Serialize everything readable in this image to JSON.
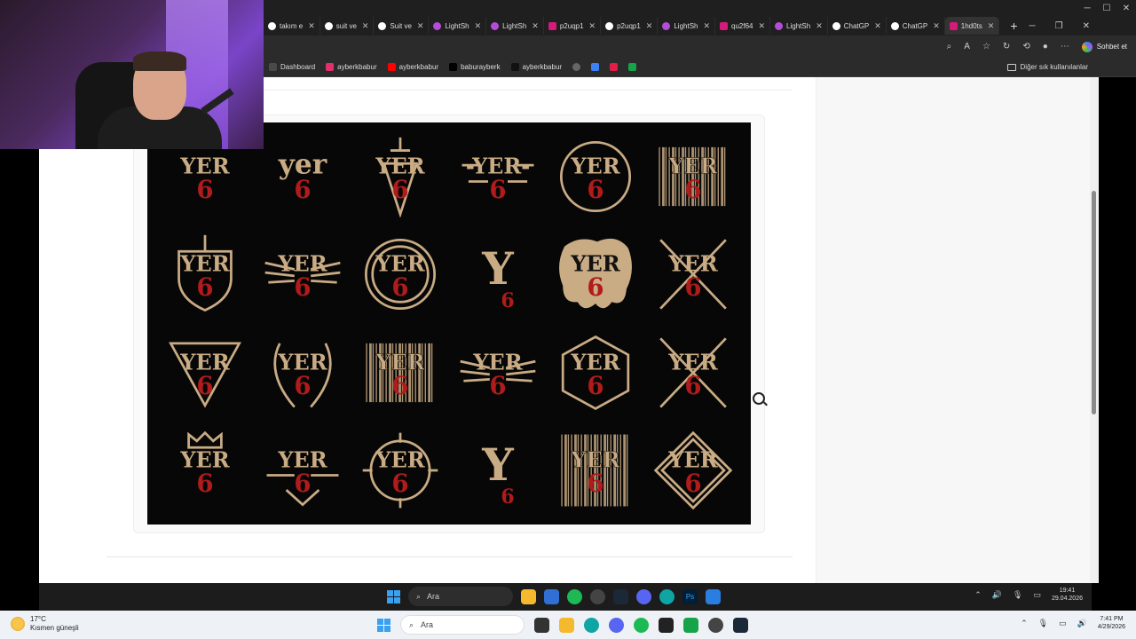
{
  "tabs": [
    {
      "label": "takım e",
      "icon": "circle",
      "active": false
    },
    {
      "label": "suit ve",
      "icon": "circle",
      "active": false
    },
    {
      "label": "Suit ve",
      "icon": "m",
      "active": false
    },
    {
      "label": "LightSh",
      "icon": "pen",
      "active": false
    },
    {
      "label": "LightSh",
      "icon": "pen",
      "active": false
    },
    {
      "label": "p2uqp1",
      "icon": "pink",
      "active": false
    },
    {
      "label": "p2uqp1",
      "icon": "globe",
      "active": false
    },
    {
      "label": "LightSh",
      "icon": "pen",
      "active": false
    },
    {
      "label": "qu2f64",
      "icon": "pink",
      "active": false
    },
    {
      "label": "LightSh",
      "icon": "pen",
      "active": false
    },
    {
      "label": "ChatGP",
      "icon": "chatgpt",
      "active": false
    },
    {
      "label": "ChatGP",
      "icon": "chatgpt",
      "active": false
    },
    {
      "label": "1hd0ts",
      "icon": "pink",
      "active": true
    }
  ],
  "toolbar": {
    "copilot_label": "Sohbet et"
  },
  "bookmarks": {
    "items": [
      {
        "label": "Dashboard",
        "color": "#4a4a4a"
      },
      {
        "label": "ayberkbabur",
        "color": "#e1306c"
      },
      {
        "label": "ayberkbabur",
        "color": "#ff0000"
      },
      {
        "label": "baburayberk",
        "color": "#000000"
      },
      {
        "label": "ayberkbabur",
        "color": "#111111"
      }
    ],
    "other_label": "Diğer sık kullanılanlar"
  },
  "logo_sheet": {
    "colors": {
      "tan": "#c9ab84",
      "red": "#b01b1b",
      "bg": "#070707"
    },
    "logos": [
      {
        "top": "YER",
        "num": "6",
        "style": "classic"
      },
      {
        "top": "yer",
        "num": "6",
        "style": "script"
      },
      {
        "top": "YER",
        "num": "6",
        "style": "dagger"
      },
      {
        "top": "-YER-",
        "num": "6",
        "style": "wings-line"
      },
      {
        "top": "YER",
        "num": "6",
        "style": "ring"
      },
      {
        "top": "YER",
        "num": "6",
        "style": "barcode-wide"
      },
      {
        "top": "YER",
        "num": "6",
        "style": "shield-dagger"
      },
      {
        "top": "YER",
        "num": "6",
        "style": "wings"
      },
      {
        "top": "YER",
        "num": "6",
        "style": "circle-badge"
      },
      {
        "top": "Y",
        "num": "6",
        "style": "big-y"
      },
      {
        "top": "YER",
        "num": "6",
        "style": "splatter"
      },
      {
        "top": "YER",
        "num": "6",
        "style": "swords"
      },
      {
        "top": "YER",
        "num": "6",
        "style": "triangle"
      },
      {
        "top": "YER",
        "num": "6",
        "style": "laurel"
      },
      {
        "top": "YER",
        "num": "6",
        "style": "barcode"
      },
      {
        "top": "YER",
        "num": "6",
        "style": "eagle"
      },
      {
        "top": "YER",
        "num": "6",
        "style": "hexagon"
      },
      {
        "top": "YER",
        "num": "6",
        "style": "crossed-knives"
      },
      {
        "top": "YER",
        "num": "6",
        "style": "crown"
      },
      {
        "top": "YER",
        "num": "6",
        "style": "chevron"
      },
      {
        "top": "YER",
        "num": "6",
        "style": "compass"
      },
      {
        "top": "Y",
        "num": "6",
        "style": "blackletter"
      },
      {
        "top": "YER",
        "num": "6",
        "style": "vertical-bars"
      },
      {
        "top": "YER",
        "num": "6",
        "style": "diamond"
      }
    ]
  },
  "inner_taskbar": {
    "search_label": "Ara",
    "time": "19:41",
    "date": "29.04.2026"
  },
  "outer_taskbar": {
    "temperature": "17°C",
    "weather": "Kısmen güneşli",
    "search_label": "Ara",
    "time": "7:41 PM",
    "date": "4/29/2026"
  }
}
